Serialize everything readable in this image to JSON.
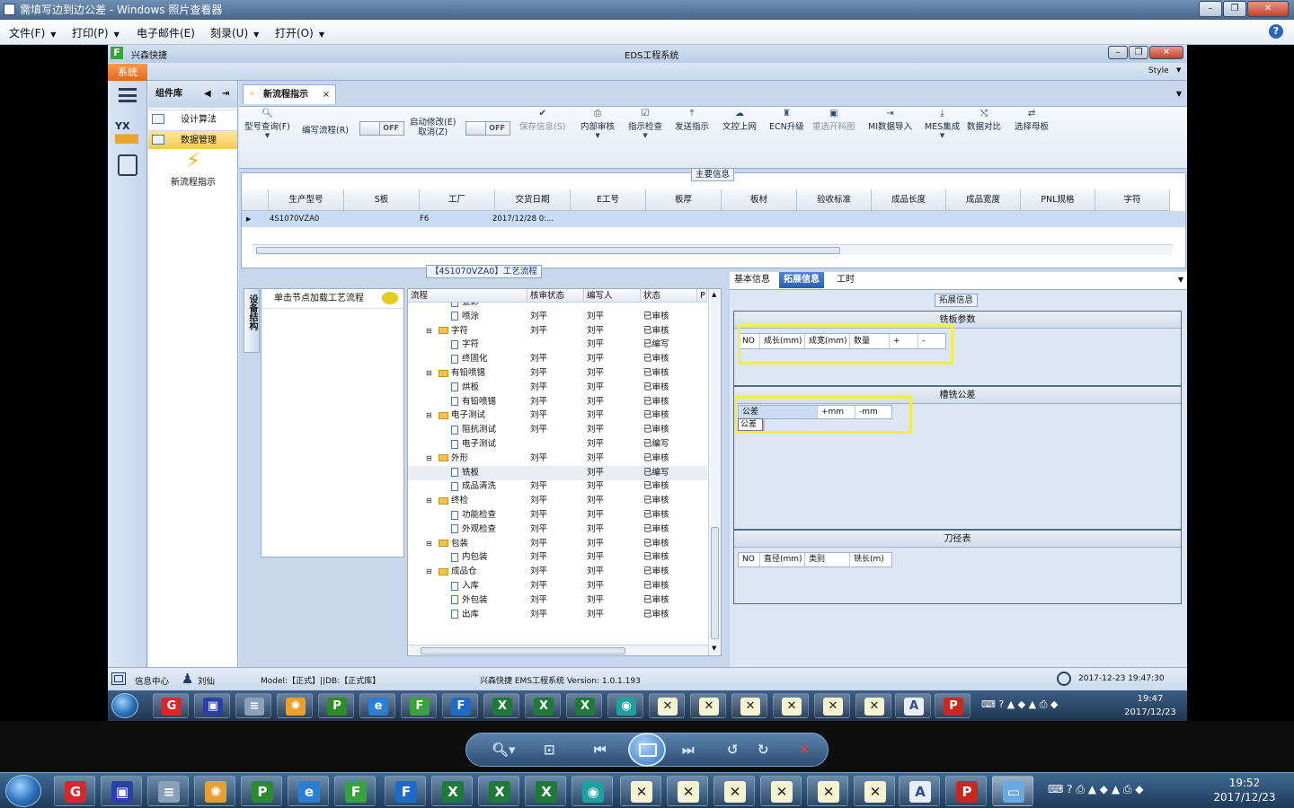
{
  "viewer": {
    "title": "需填写边到边公差 - Windows 照片查看器",
    "menu": [
      "文件(F)",
      "打印(P)",
      "电子邮件(E)",
      "刻录(U)",
      "打开(O)"
    ],
    "help": "?"
  },
  "eds": {
    "app_short": "兴森快捷",
    "title": "EDS工程系统",
    "system_tab": "系统",
    "style_label": "Style",
    "component_lib": "组件库",
    "lib_items": [
      "设计算法",
      "数据管理"
    ],
    "new_flow_label": "新流程指示",
    "doc_tab": "新流程指示",
    "toolbar": {
      "buttons": [
        {
          "label": "型号查询(F)",
          "icon": "search-icon",
          "enabled": true
        },
        {
          "label": "编写流程(R)",
          "icon": "none",
          "enabled": true
        },
        {
          "label": "启动修改(E)",
          "label2": "取消(Z)",
          "icon": "none",
          "enabled": true
        },
        {
          "label": "保存信息(S)",
          "icon": "check-icon",
          "enabled": false
        },
        {
          "label": "内部审核",
          "icon": "print-icon",
          "enabled": true
        },
        {
          "label": "指示检查",
          "icon": "check-box-icon",
          "enabled": true
        },
        {
          "label": "发送指示",
          "icon": "upload-icon",
          "enabled": true
        },
        {
          "label": "文控上网",
          "icon": "cloud-icon",
          "enabled": true
        },
        {
          "label": "ECN升级",
          "icon": "ecn-icon",
          "enabled": true
        },
        {
          "label": "重选开料图",
          "icon": "image-icon",
          "enabled": false
        },
        {
          "label": "MI数据导入",
          "icon": "import-icon",
          "enabled": true
        },
        {
          "label": "MES集成",
          "icon": "download-icon",
          "enabled": true
        },
        {
          "label": "数据对比",
          "icon": "compare-icon",
          "enabled": true
        },
        {
          "label": "选择母板",
          "icon": "shuffle-icon",
          "enabled": true
        }
      ],
      "toggle1": "OFF",
      "toggle2": "OFF"
    },
    "main_info": {
      "label": "主要信息",
      "columns": [
        "生产型号",
        "S板",
        "工厂",
        "交货日期",
        "E工号",
        "板厚",
        "板材",
        "验收标准",
        "成品长度",
        "成品宽度",
        "PNL规格",
        "字符"
      ],
      "row": [
        "4S1070VZA0",
        "",
        "F6",
        "2017/12/28 0:...",
        "",
        "",
        "",
        "",
        "",
        "",
        "",
        ""
      ]
    },
    "process": {
      "label": "【4S1070VZA0】工艺流程",
      "side_label": "设备结构",
      "hint": "单击节点加载工艺流程",
      "columns": [
        "流程",
        "核审状态",
        "编写人",
        "状态",
        "P"
      ],
      "rows": [
        {
          "name": "显影",
          "level": 2,
          "folder": false,
          "reviewer": "",
          "writer": "",
          "status": ""
        },
        {
          "name": "喷涂",
          "level": 2,
          "folder": false,
          "reviewer": "刘平",
          "writer": "刘平",
          "status": "已审核"
        },
        {
          "name": "字符",
          "level": 1,
          "folder": true,
          "reviewer": "刘平",
          "writer": "刘平",
          "status": "已审核"
        },
        {
          "name": "字符",
          "level": 2,
          "folder": false,
          "reviewer": "",
          "writer": "刘平",
          "status": "已编写"
        },
        {
          "name": "终固化",
          "level": 2,
          "folder": false,
          "reviewer": "刘平",
          "writer": "刘平",
          "status": "已审核"
        },
        {
          "name": "有铅喷锡",
          "level": 1,
          "folder": true,
          "reviewer": "刘平",
          "writer": "刘平",
          "status": "已审核"
        },
        {
          "name": "烘板",
          "level": 2,
          "folder": false,
          "reviewer": "刘平",
          "writer": "刘平",
          "status": "已审核"
        },
        {
          "name": "有铅喷锡",
          "level": 2,
          "folder": false,
          "reviewer": "刘平",
          "writer": "刘平",
          "status": "已审核"
        },
        {
          "name": "电子测试",
          "level": 1,
          "folder": true,
          "reviewer": "刘平",
          "writer": "刘平",
          "status": "已审核"
        },
        {
          "name": "阻抗测试",
          "level": 2,
          "folder": false,
          "reviewer": "刘平",
          "writer": "刘平",
          "status": "已审核"
        },
        {
          "name": "电子测试",
          "level": 2,
          "folder": false,
          "reviewer": "",
          "writer": "刘平",
          "status": "已编写"
        },
        {
          "name": "外形",
          "level": 1,
          "folder": true,
          "reviewer": "刘平",
          "writer": "刘平",
          "status": "已审核"
        },
        {
          "name": "铣板",
          "level": 2,
          "folder": false,
          "reviewer": "",
          "writer": "刘平",
          "status": "已编写"
        },
        {
          "name": "成品清洗",
          "level": 2,
          "folder": false,
          "reviewer": "刘平",
          "writer": "刘平",
          "status": "已审核"
        },
        {
          "name": "终检",
          "level": 1,
          "folder": true,
          "reviewer": "刘平",
          "writer": "刘平",
          "status": "已审核"
        },
        {
          "name": "功能检查",
          "level": 2,
          "folder": false,
          "reviewer": "刘平",
          "writer": "刘平",
          "status": "已审核"
        },
        {
          "name": "外观检查",
          "level": 2,
          "folder": false,
          "reviewer": "刘平",
          "writer": "刘平",
          "status": "已审核"
        },
        {
          "name": "包装",
          "level": 1,
          "folder": true,
          "reviewer": "刘平",
          "writer": "刘平",
          "status": "已审核"
        },
        {
          "name": "内包装",
          "level": 2,
          "folder": false,
          "reviewer": "刘平",
          "writer": "刘平",
          "status": "已审核"
        },
        {
          "name": "成品仓",
          "level": 1,
          "folder": true,
          "reviewer": "刘平",
          "writer": "刘平",
          "status": "已审核"
        },
        {
          "name": "入库",
          "level": 2,
          "folder": false,
          "reviewer": "刘平",
          "writer": "刘平",
          "status": "已审核"
        },
        {
          "name": "外包装",
          "level": 2,
          "folder": false,
          "reviewer": "刘平",
          "writer": "刘平",
          "status": "已审核"
        },
        {
          "name": "出库",
          "level": 2,
          "folder": false,
          "reviewer": "刘平",
          "writer": "刘平",
          "status": "已审核"
        }
      ]
    },
    "ext": {
      "tabs": [
        "基本信息",
        "拓展信息",
        "工时"
      ],
      "label": "拓展信息",
      "mill_params": {
        "title": "铣板参数",
        "columns": [
          "NO",
          "成长(mm)",
          "成宽(mm)",
          "数量",
          "+",
          "-"
        ]
      },
      "slot_tol": {
        "title": "槽铣公差",
        "columns": [
          "公差",
          "+mm",
          "-mm"
        ],
        "tooltip": "公差"
      },
      "tool_table": {
        "title": "刀径表",
        "columns": [
          "NO",
          "直径(mm)",
          "类别",
          "铣长(m)"
        ]
      }
    },
    "status": {
      "info_center": "信息中心",
      "user": "刘仙",
      "model": "Model:【正式】||DB:【正式库】",
      "version": "兴森快捷 EMS工程系统 Version: 1.0.1.193",
      "datetime": "2017-12-23 19:47:30"
    },
    "inner_clock": {
      "time": "19:47",
      "date": "2017/12/23"
    }
  },
  "taskbar": {
    "clock_time": "19:52",
    "clock_date": "2017/12/23"
  }
}
